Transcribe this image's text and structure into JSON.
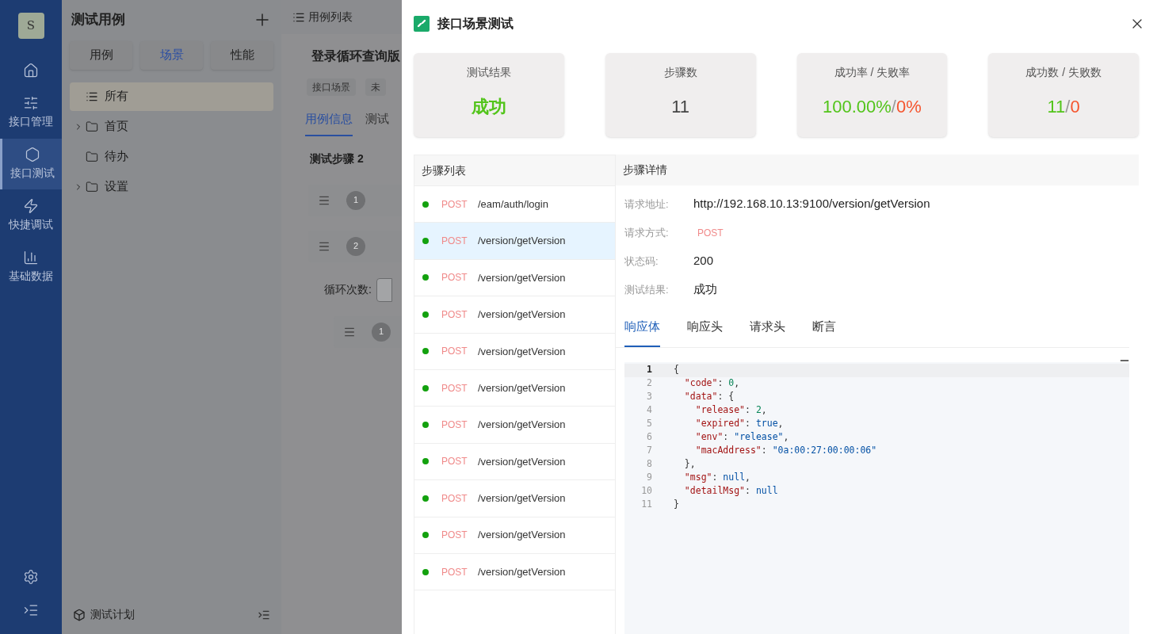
{
  "nav": {
    "avatar": "S",
    "items": [
      {
        "kind": "home",
        "selected": false
      },
      {
        "kind": "sliders",
        "label": "接口管理",
        "selected": false
      },
      {
        "kind": "hexagon",
        "label": "接口测试",
        "selected": true
      },
      {
        "kind": "zap",
        "label": "快捷调试",
        "selected": false
      },
      {
        "kind": "chart",
        "label": "基础数据",
        "selected": false
      }
    ]
  },
  "case_panel": {
    "title": "测试用例",
    "tabs": [
      {
        "label": "用例",
        "selected": false
      },
      {
        "label": "场景",
        "selected": true
      },
      {
        "label": "性能",
        "selected": false
      }
    ],
    "tree": [
      {
        "kind": "list",
        "label": "所有",
        "expandable": false,
        "selected": true
      },
      {
        "kind": "folder",
        "label": "首页",
        "expandable": true,
        "selected": false
      },
      {
        "kind": "folder",
        "label": "待办",
        "expandable": false,
        "selected": false
      },
      {
        "kind": "folder",
        "label": "设置",
        "expandable": true,
        "selected": false
      }
    ],
    "footer": "测试计划"
  },
  "case_view": {
    "tab": "用例列表",
    "title": "登录循环查询版",
    "tags": [
      "接口场景",
      "未"
    ],
    "tabs": [
      {
        "label": "用例信息",
        "selected": true
      },
      {
        "label": "测试",
        "selected": false
      }
    ],
    "section": "测试步骤 2",
    "steps": [
      {
        "number": "1",
        "nested": false
      },
      {
        "number": "2",
        "nested": false
      },
      {
        "number": "1",
        "nested": true
      }
    ],
    "loop_label": "循环次数:"
  },
  "drawer": {
    "title": "接口场景测试",
    "stats": [
      {
        "label": "测试结果",
        "parts": [
          {
            "text": "成功",
            "color": "#52c41a"
          }
        ]
      },
      {
        "label": "步骤数",
        "parts": [
          {
            "text": "11",
            "color": "#444444"
          }
        ]
      },
      {
        "label": "成功率 / 失败率",
        "parts": [
          {
            "text": "100.00%",
            "color": "#52c41a"
          },
          {
            "text": "/",
            "color": "#999999"
          },
          {
            "text": "0%",
            "color": "#f5542d"
          }
        ]
      },
      {
        "label": "成功数 / 失败数",
        "parts": [
          {
            "text": "11",
            "color": "#52c41a"
          },
          {
            "text": "/",
            "color": "#999999"
          },
          {
            "text": "0",
            "color": "#f5542d"
          }
        ]
      }
    ],
    "step_list": {
      "title": "步骤列表",
      "steps": [
        {
          "method": "POST",
          "path": "/eam/auth/login",
          "color": "#13a10e",
          "selected": false
        },
        {
          "method": "POST",
          "path": "/version/getVersion",
          "color": "#13a10e",
          "selected": true
        },
        {
          "method": "POST",
          "path": "/version/getVersion",
          "color": "#13a10e",
          "selected": false
        },
        {
          "method": "POST",
          "path": "/version/getVersion",
          "color": "#13a10e",
          "selected": false
        },
        {
          "method": "POST",
          "path": "/version/getVersion",
          "color": "#13a10e",
          "selected": false
        },
        {
          "method": "POST",
          "path": "/version/getVersion",
          "color": "#13a10e",
          "selected": false
        },
        {
          "method": "POST",
          "path": "/version/getVersion",
          "color": "#13a10e",
          "selected": false
        },
        {
          "method": "POST",
          "path": "/version/getVersion",
          "color": "#13a10e",
          "selected": false
        },
        {
          "method": "POST",
          "path": "/version/getVersion",
          "color": "#13a10e",
          "selected": false
        },
        {
          "method": "POST",
          "path": "/version/getVersion",
          "color": "#13a10e",
          "selected": false
        },
        {
          "method": "POST",
          "path": "/version/getVersion",
          "color": "#13a10e",
          "selected": false
        }
      ]
    },
    "detail": {
      "title": "步骤详情",
      "fields": [
        {
          "label": "请求地址:",
          "value": "http://192.168.10.13:9100/version/getVersion",
          "kind": "text"
        },
        {
          "label": "请求方式:",
          "value": "POST",
          "kind": "method"
        },
        {
          "label": "状态码:",
          "value": "200",
          "kind": "text"
        },
        {
          "label": "测试结果:",
          "value": "成功",
          "kind": "text"
        }
      ],
      "tabs": [
        {
          "label": "响应体",
          "selected": true
        },
        {
          "label": "响应头",
          "selected": false
        },
        {
          "label": "请求头",
          "selected": false
        },
        {
          "label": "断言",
          "selected": false
        }
      ],
      "code": [
        {
          "no": "1",
          "text": "{",
          "active": true
        },
        {
          "no": "2",
          "text": "  \"code\": 0,",
          "active": false
        },
        {
          "no": "3",
          "text": "  \"data\": {",
          "active": false
        },
        {
          "no": "4",
          "text": "    \"release\": 2,",
          "active": false
        },
        {
          "no": "5",
          "text": "    \"expired\": true,",
          "active": false
        },
        {
          "no": "6",
          "text": "    \"env\": \"release\",",
          "active": false
        },
        {
          "no": "7",
          "text": "    \"macAddress\": \"0a:00:27:00:00:06\"",
          "active": false
        },
        {
          "no": "8",
          "text": "  },",
          "active": false
        },
        {
          "no": "9",
          "text": "  \"msg\": null,",
          "active": false
        },
        {
          "no": "10",
          "text": "  \"detailMsg\": null",
          "active": false
        },
        {
          "no": "11",
          "text": "}",
          "active": false
        }
      ]
    }
  }
}
